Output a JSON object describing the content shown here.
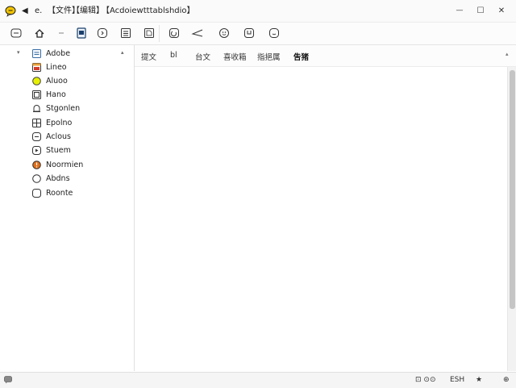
{
  "titlebar": {
    "app_icon": "chat-bubble-app-icon",
    "arrow_glyph": "◀",
    "text_1": "e.",
    "text_2": "【文件】",
    "text_3": "【编辑】",
    "text_4": "【Acdoiewtttablshdio】",
    "controls": {
      "minimize": "—",
      "maximize": "☐",
      "close": "✕"
    }
  },
  "toolbar": {
    "buttons": [
      "back-icon",
      "home-icon",
      "dot-icon",
      "document-icon",
      "speech-icon",
      "list-icon",
      "page-icon",
      "refresh-icon",
      "pointer-icon",
      "emoji-icon",
      "save-icon",
      "face-icon"
    ]
  },
  "sidebar": {
    "collapse_glyph": "▾",
    "expand_glyph": "▴",
    "items": [
      {
        "label": "Adobe",
        "icon": "document-icon",
        "color": "#3a6ea5"
      },
      {
        "label": "Lineo",
        "icon": "window-icon",
        "color": "#e8a13a"
      },
      {
        "label": "Aluoo",
        "icon": "circle-icon",
        "color": "#c8d400"
      },
      {
        "label": "Hano",
        "icon": "image-icon",
        "color": "#444444"
      },
      {
        "label": "Stgonlen",
        "icon": "bell-icon",
        "color": "#444444"
      },
      {
        "label": "Epolno",
        "icon": "grid-icon",
        "color": "#444444"
      },
      {
        "label": "Aclous",
        "icon": "minus-icon",
        "color": "#444444"
      },
      {
        "label": "Stuem",
        "icon": "play-icon",
        "color": "#444444"
      },
      {
        "label": "Noormien",
        "icon": "alert-icon",
        "color": "#e0701a"
      },
      {
        "label": "Abdns",
        "icon": "circle-outline-icon",
        "color": "#444444"
      },
      {
        "label": "Roonte",
        "icon": "square-outline-icon",
        "color": "#444444"
      }
    ]
  },
  "tabs": [
    {
      "label": "提文",
      "active": false
    },
    {
      "label": "bl",
      "active": false
    },
    {
      "label": "台文",
      "active": false
    },
    {
      "label": "喜收箱",
      "active": false
    },
    {
      "label": "指挹属",
      "active": false
    },
    {
      "label": "吿猪",
      "active": true
    }
  ],
  "tabbar_more": "▴",
  "statusbar": {
    "left_icon": "chat-icon",
    "text_1": "⊡ ⊙⊙",
    "text_2": "ESH",
    "text_3": "★",
    "text_4": "⊕"
  }
}
